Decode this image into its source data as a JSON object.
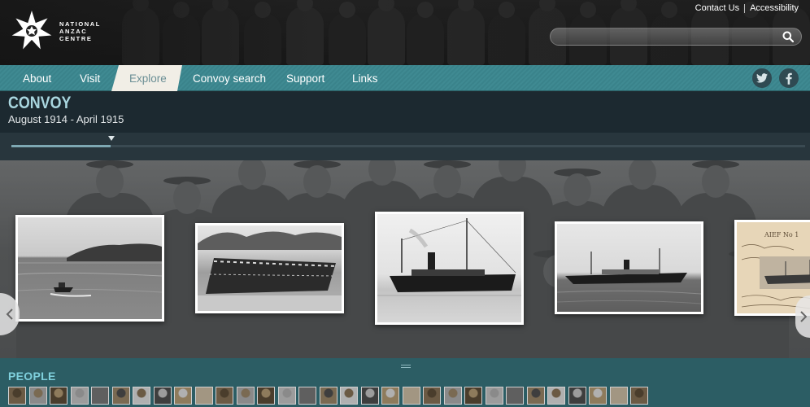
{
  "site": {
    "logo_line1": "NATIONAL",
    "logo_line2": "ANZAC",
    "logo_line3": "CENTRE",
    "logo_icon": "anzac-star-logo-icon"
  },
  "top_links": {
    "contact": "Contact Us",
    "accessibility": "Accessibility"
  },
  "search": {
    "value": "",
    "placeholder": "",
    "icon": "search-icon"
  },
  "nav": {
    "items": [
      "About",
      "Visit",
      "Explore",
      "Convoy search",
      "Support",
      "Links"
    ],
    "active": "Explore"
  },
  "social": {
    "twitter_icon": "twitter-icon",
    "facebook_icon": "facebook-icon"
  },
  "page": {
    "title": "CONVOY",
    "subtitle": "August 1914 - April 1915"
  },
  "gallery": {
    "left_arrow_icon": "chevron-left-icon",
    "right_arrow_icon": "chevron-right-icon"
  },
  "people": {
    "label": "PEOPLE",
    "thumb_count": 31
  },
  "colors": {
    "nav_teal": "#3f8a92",
    "title_blue": "#a9d6df",
    "people_bar": "#2c5d64",
    "people_label": "#7fd0dd",
    "active_tab": "#f1eee6"
  }
}
